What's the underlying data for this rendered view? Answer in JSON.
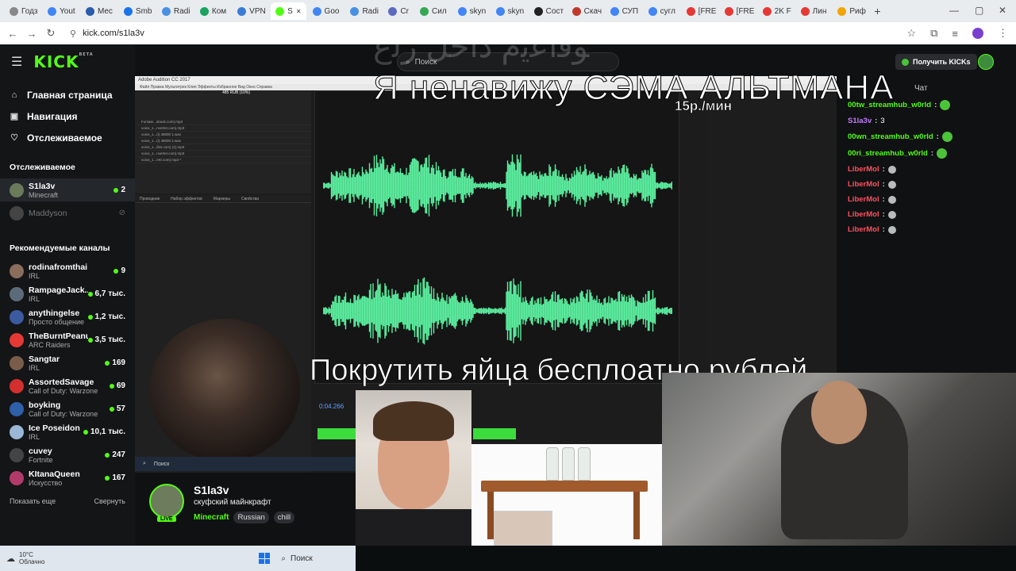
{
  "browser": {
    "tabs": [
      {
        "label": "Годз",
        "color": "#888888"
      },
      {
        "label": "Yout",
        "color": "#4285f4"
      },
      {
        "label": "Mec",
        "color": "#2a5caa"
      },
      {
        "label": "Smb",
        "color": "#1a73e8"
      },
      {
        "label": "Radi",
        "color": "#4a90e2"
      },
      {
        "label": "Ком",
        "color": "#1aa260"
      },
      {
        "label": "VPN",
        "color": "#3a7bd5"
      },
      {
        "label": "S",
        "color": "#53fc18",
        "active": true
      },
      {
        "label": "Goo",
        "color": "#4285f4"
      },
      {
        "label": "Radi",
        "color": "#4a90e2"
      },
      {
        "label": "Cr",
        "color": "#5c6bc0"
      },
      {
        "label": "Сил",
        "color": "#34a853"
      },
      {
        "label": "skyn",
        "color": "#4285f4"
      },
      {
        "label": "skyn",
        "color": "#4285f4"
      },
      {
        "label": "Сост",
        "color": "#222222"
      },
      {
        "label": "Скач",
        "color": "#c0392b"
      },
      {
        "label": "СУП",
        "color": "#4285f4"
      },
      {
        "label": "сугл",
        "color": "#4285f4"
      },
      {
        "label": "[FRE",
        "color": "#e53935"
      },
      {
        "label": "[FRE",
        "color": "#e53935"
      },
      {
        "label": "2K F",
        "color": "#e53935"
      },
      {
        "label": "Лин",
        "color": "#e53935"
      },
      {
        "label": "Риф",
        "color": "#f0a500"
      }
    ],
    "url": "kick.com/s1la3v"
  },
  "sidebar": {
    "logo": "KICK",
    "logo_beta": "BETA",
    "nav": [
      {
        "label": "Главная страница",
        "icon": "home-icon"
      },
      {
        "label": "Навигация",
        "icon": "compass-icon"
      },
      {
        "label": "Отслеживаемое",
        "icon": "heart-icon"
      }
    ],
    "following_title": "Отслеживаемое",
    "following": [
      {
        "name": "S1la3v",
        "category": "Minecraft",
        "viewers": "2",
        "color": "#6a7a5a",
        "selected": true
      },
      {
        "name": "Maddyson",
        "category": "",
        "viewers": "",
        "color": "#444444",
        "offline": true
      }
    ],
    "recommended_title": "Рекомендуемые каналы",
    "recommended": [
      {
        "name": "rodinafromthai",
        "category": "IRL",
        "viewers": "9",
        "color": "#8a6d5c"
      },
      {
        "name": "RampageJack...",
        "category": "IRL",
        "viewers": "6,7 тыс.",
        "color": "#5c6b7a"
      },
      {
        "name": "anythingelse",
        "category": "Просто общение",
        "viewers": "1,2 тыс.",
        "color": "#3b5aa0"
      },
      {
        "name": "TheBurntPeanut",
        "category": "ARC Raiders",
        "viewers": "3,5 тыс.",
        "color": "#e53935"
      },
      {
        "name": "Sangtar",
        "category": "IRL",
        "viewers": "169",
        "color": "#7a5c4a"
      },
      {
        "name": "AssortedSavage",
        "category": "Call of Duty: Warzone",
        "viewers": "69",
        "color": "#d32f2f"
      },
      {
        "name": "boyking",
        "category": "Call of Duty: Warzone",
        "viewers": "57",
        "color": "#2e5fa8"
      },
      {
        "name": "Ice Poseidon",
        "category": "IRL",
        "viewers": "10,1 тыс.",
        "color": "#9ab7d6"
      },
      {
        "name": "cuvey",
        "category": "Fortnite",
        "viewers": "247",
        "color": "#444444"
      },
      {
        "name": "KItanaQueen",
        "category": "Искусство",
        "viewers": "167",
        "color": "#b23a6a"
      }
    ],
    "show_more": "Показать еще",
    "collapse": "Свернуть"
  },
  "topbar": {
    "search_placeholder": "Поиск",
    "get_kicks": "Получить KICKs"
  },
  "overlay": {
    "promo_text": "Я ненавижу СЭМА АЛЬТМАНА",
    "price": "15р./мин",
    "caption": "Покрутить яйца бесплоатно рублей"
  },
  "audition": {
    "title": "Adobe Audition CC 2017",
    "time": "0:04.266",
    "rub_label": "485 RUB (10%)",
    "files": [
      "Forsaie...ubuvk.com).mp3",
      "voice_1...nverter.com).mp3",
      "voice_1...(i) 48000 1.wav",
      "voice_1...(i) 48000 2.wav",
      "voice_1...ifier.com) (1).mp3",
      "voice_1...nverter.com).mp3",
      "voice_1...ertr.com).mp3 *"
    ],
    "fx_tabs": [
      "Проводник",
      "Набор эффектов",
      "Маркеры",
      "Свойства"
    ]
  },
  "chat": {
    "title": "Чат",
    "messages": [
      {
        "user": "00tw_streamhub_w0rld",
        "color": "#53fc18",
        "text": "",
        "emote": "green"
      },
      {
        "user": "S1la3v",
        "color": "#c17bff",
        "text": "3",
        "emote": ""
      },
      {
        "user": "00wn_streamhub_w0rld",
        "color": "#53fc18",
        "text": "",
        "emote": "green"
      },
      {
        "user": "00ri_streamhub_w0rld",
        "color": "#53fc18",
        "text": "",
        "emote": "green"
      },
      {
        "user": "LiberMol",
        "color": "#ff4f5e",
        "text": "",
        "emote": "gray"
      },
      {
        "user": "LiberMol",
        "color": "#ff4f5e",
        "text": "",
        "emote": "gray"
      },
      {
        "user": "LiberMol",
        "color": "#ff4f5e",
        "text": "",
        "emote": "gray"
      },
      {
        "user": "LiberMol",
        "color": "#ff4f5e",
        "text": "",
        "emote": "gray"
      },
      {
        "user": "LiberMol",
        "color": "#ff4f5e",
        "text": "",
        "emote": "gray"
      }
    ]
  },
  "streamer": {
    "name": "S1la3v",
    "title": "скуфский майнкрафт",
    "category": "Minecraft",
    "tags": [
      "Russian",
      "chill"
    ],
    "live": "LIVE"
  },
  "taskbar": {
    "temp": "10°C",
    "weather": "Облачно",
    "search": "Поиск"
  },
  "mini_taskbar": {
    "search": "Поиск"
  }
}
